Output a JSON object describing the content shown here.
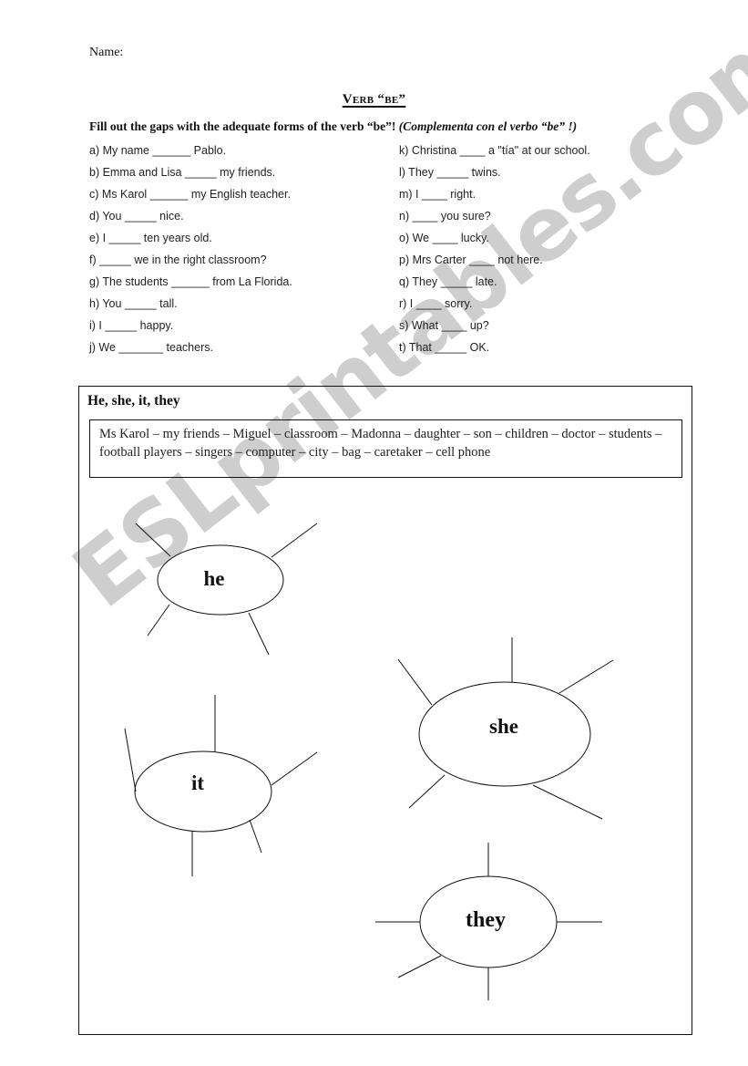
{
  "header": {
    "name_label": "Name:",
    "title": "Verb “be”",
    "instructions_en": "Fill out the gaps with the adequate forms of the verb “be”!",
    "instructions_es": "(Complementa con el verbo “be” !)"
  },
  "exercises_left": [
    "a) My name ______ Pablo.",
    "b) Emma and Lisa _____ my friends.",
    "c) Ms Karol ______ my English teacher.",
    "d) You _____ nice.",
    "e) I _____ ten years old.",
    "f) _____ we in the right classroom?",
    "g) The students ______ from La Florida.",
    "h) You _____ tall.",
    "i) I _____ happy.",
    "j) We _______ teachers."
  ],
  "exercises_right": [
    "k) Christina ____ a \"tía\" at our school.",
    "l) They _____ twins.",
    "m) I ____ right.",
    "n) ____ you sure?",
    "o) We ____ lucky.",
    "p) Mrs Carter ____ not here.",
    "q) They _____ late.",
    "r) I ____ sorry.",
    "s) What ____ up?",
    "t) That _____ OK."
  ],
  "section2": {
    "title": "He, she, it, they",
    "word_bank": "Ms Karol – my friends – Miguel – classroom – Madonna – daughter – son – children – doctor – students – football players – singers – computer – city – bag – caretaker – cell phone",
    "bubbles": {
      "he": "he",
      "she": "she",
      "it": "it",
      "they": "they"
    }
  },
  "watermark": "ESLprintables.com"
}
